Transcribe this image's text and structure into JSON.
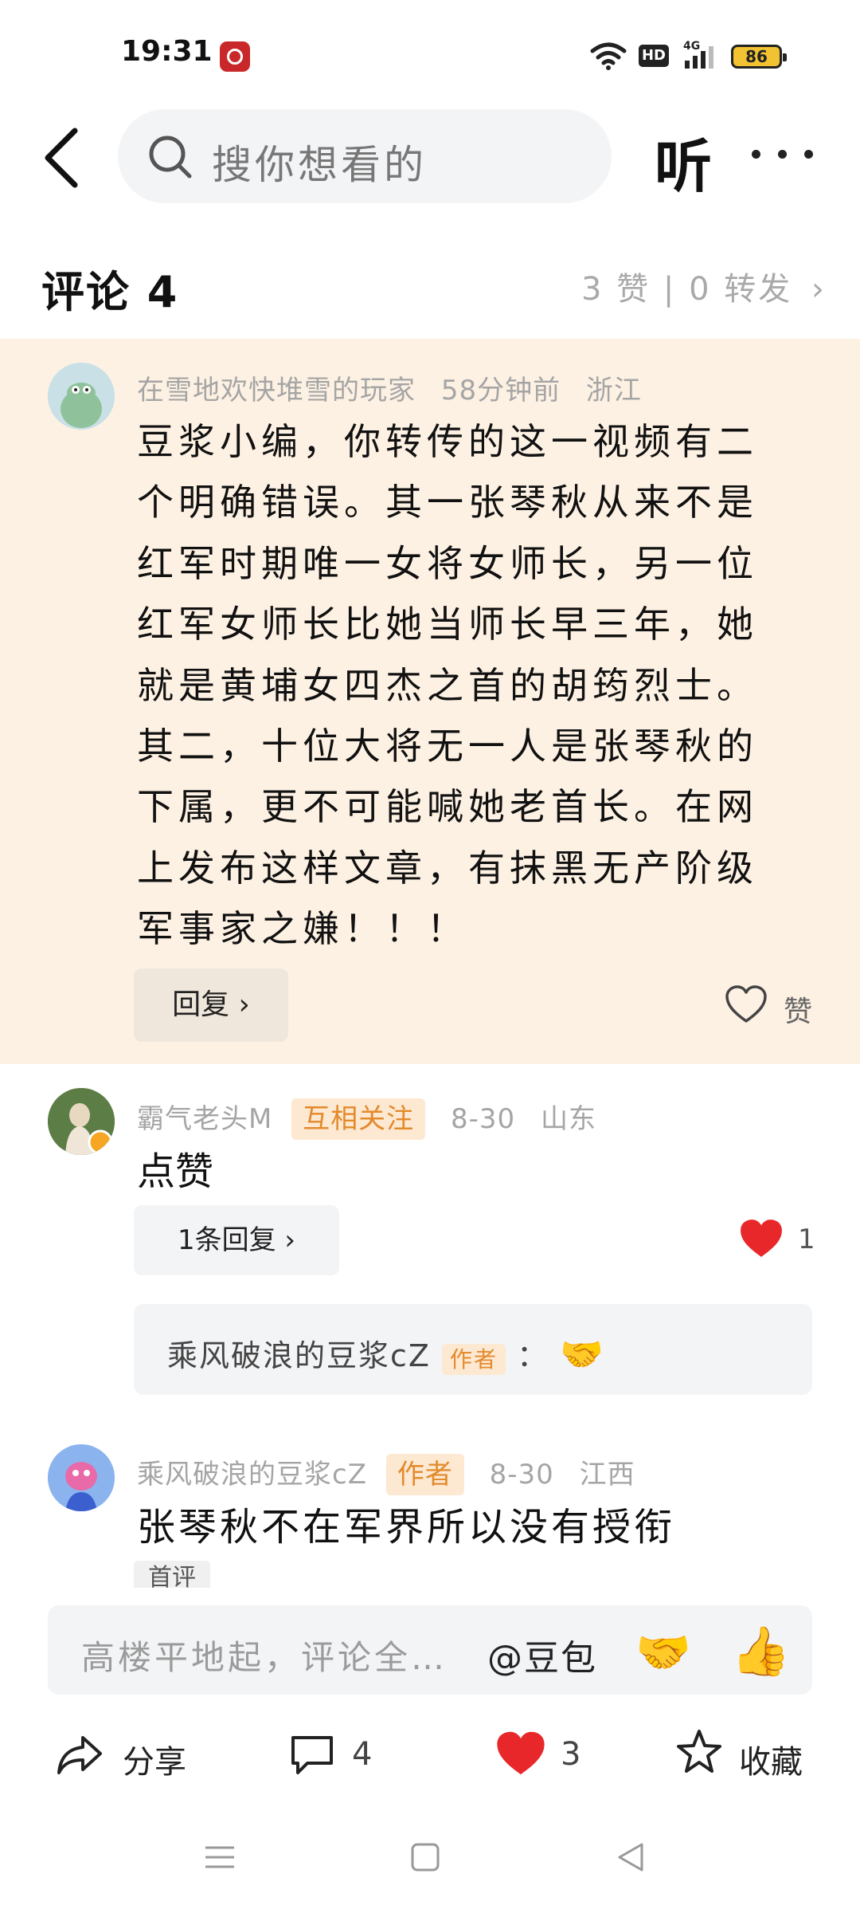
{
  "status_bar": {
    "time": "19:31",
    "network": "4G",
    "battery": "86"
  },
  "header": {
    "search_placeholder": "搜你想看的",
    "listen_label": "听"
  },
  "comments_section": {
    "title": "评论 4",
    "stats": "3 赞 | 0 转发"
  },
  "comments": [
    {
      "username": "在雪地欢快堆雪的玩家",
      "time": "58分钟前",
      "location": "浙江",
      "lines": [
        "豆浆小编，你转传的这一视频有二",
        "个明确错误。其一张琴秋从来不是",
        "红军时期唯一女将女师长，另一位",
        "红军女师长比她当师长早三年，她",
        "就是黄埔女四杰之首的胡筠烈士。",
        "其二，十位大将无一人是张琴秋的",
        "下属，更不可能喊她老首长。在网",
        "上发布这样文章，有抹黑无产阶级",
        "军事家之嫌！！！"
      ],
      "reply_label": "回复",
      "like_label": "赞"
    },
    {
      "username": "霸气老头M",
      "tag": "互相关注",
      "time": "8-30",
      "location": "山东",
      "text": "点赞",
      "replies_label": "1条回复",
      "like_count": "1",
      "subreply": {
        "author": "乘风破浪的豆浆cZ",
        "author_tag": "作者",
        "text": "："
      }
    },
    {
      "username": "乘风破浪的豆浆cZ",
      "tag": "作者",
      "time": "8-30",
      "location": "江西",
      "text": "张琴秋不在军界所以没有授衔",
      "badge": "首评"
    }
  ],
  "comment_input": {
    "placeholder": "高楼平地起，评论全…",
    "mention": "@豆包"
  },
  "bottom_bar": {
    "share_label": "分享",
    "comment_count": "4",
    "like_count": "3",
    "favorite_label": "收藏"
  },
  "colors": {
    "highlight_bg": "#fdf1e3",
    "tag_bg": "#fde8d2",
    "tag_text": "#e38a2b",
    "heart": "#e8272b"
  },
  "icons": [
    "back-arrow-icon",
    "search-icon",
    "more-icon",
    "heart-outline-icon",
    "heart-filled-icon",
    "chevron-right-icon",
    "share-icon",
    "comment-icon",
    "star-icon",
    "handshake-emoji",
    "thumbs-up-emoji"
  ]
}
